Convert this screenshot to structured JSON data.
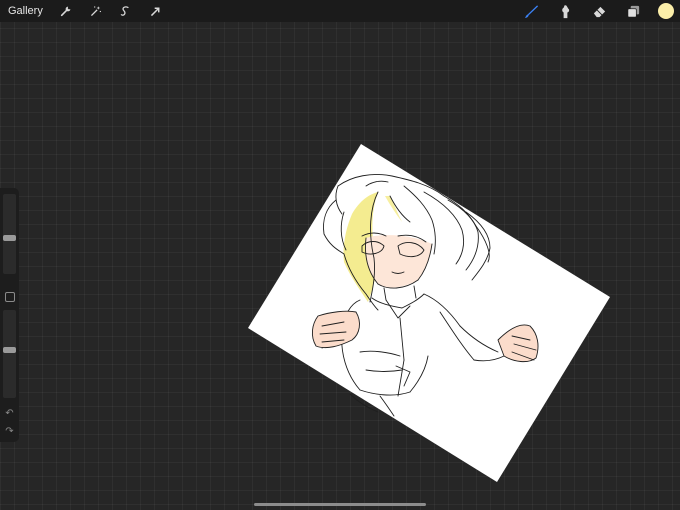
{
  "toolbar": {
    "gallery_label": "Gallery",
    "left_icons": [
      "wrench-icon",
      "magic-wand-icon",
      "selection-icon",
      "transform-arrow-icon"
    ],
    "right_icons": [
      "brush-icon",
      "smudge-icon",
      "eraser-icon",
      "layers-icon"
    ],
    "active_tool": "brush",
    "current_color": "#fbeea9"
  },
  "sidebar": {
    "brush_size_level": 0.45,
    "brush_opacity_level": 0.55,
    "undo_icon": "undo-icon",
    "redo_icon": "redo-icon"
  },
  "colors": {
    "canvas_bg": "#262626",
    "paper": "#ffffff",
    "hair_highlight": "#f5ec8f",
    "skin": "#fbdccb",
    "active_tool": "#3b82f6"
  }
}
